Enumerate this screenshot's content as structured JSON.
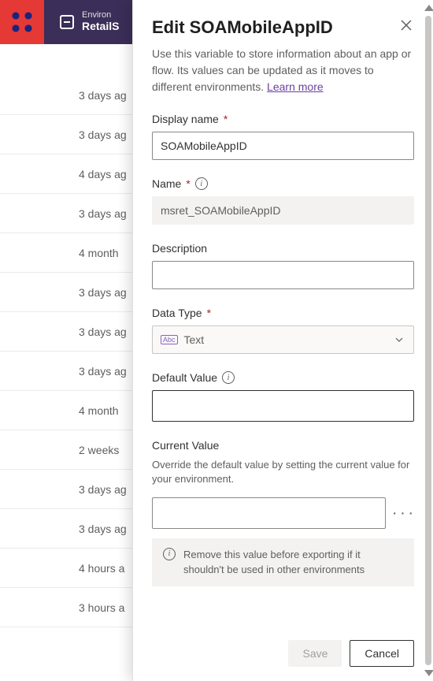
{
  "topbar": {
    "env_label": "Environ",
    "env_name": "RetailS"
  },
  "bg_list": [
    "3 days ag",
    "3 days ag",
    "4 days ag",
    "3 days ag",
    "4 month",
    "3 days ag",
    "3 days ag",
    "3 days ag",
    "4 month",
    "2 weeks",
    "3 days ag",
    "3 days ag",
    "4 hours a",
    "3 hours a"
  ],
  "panel": {
    "title": "Edit SOAMobileAppID",
    "description": "Use this variable to store information about an app or flow. Its values can be updated as it moves to different environments. ",
    "learn_more": "Learn more",
    "fields": {
      "display_name": {
        "label": "Display name",
        "value": "SOAMobileAppID"
      },
      "name": {
        "label": "Name",
        "value": "msret_SOAMobileAppID"
      },
      "description": {
        "label": "Description",
        "value": ""
      },
      "data_type": {
        "label": "Data Type",
        "value": "Text"
      },
      "default_value": {
        "label": "Default Value",
        "value": ""
      },
      "current_value": {
        "label": "Current Value",
        "help": "Override the default value by setting the current value for your environment.",
        "value": "",
        "callout": "Remove this value before exporting if it shouldn't be used in other environments"
      }
    },
    "buttons": {
      "save": "Save",
      "cancel": "Cancel"
    }
  }
}
